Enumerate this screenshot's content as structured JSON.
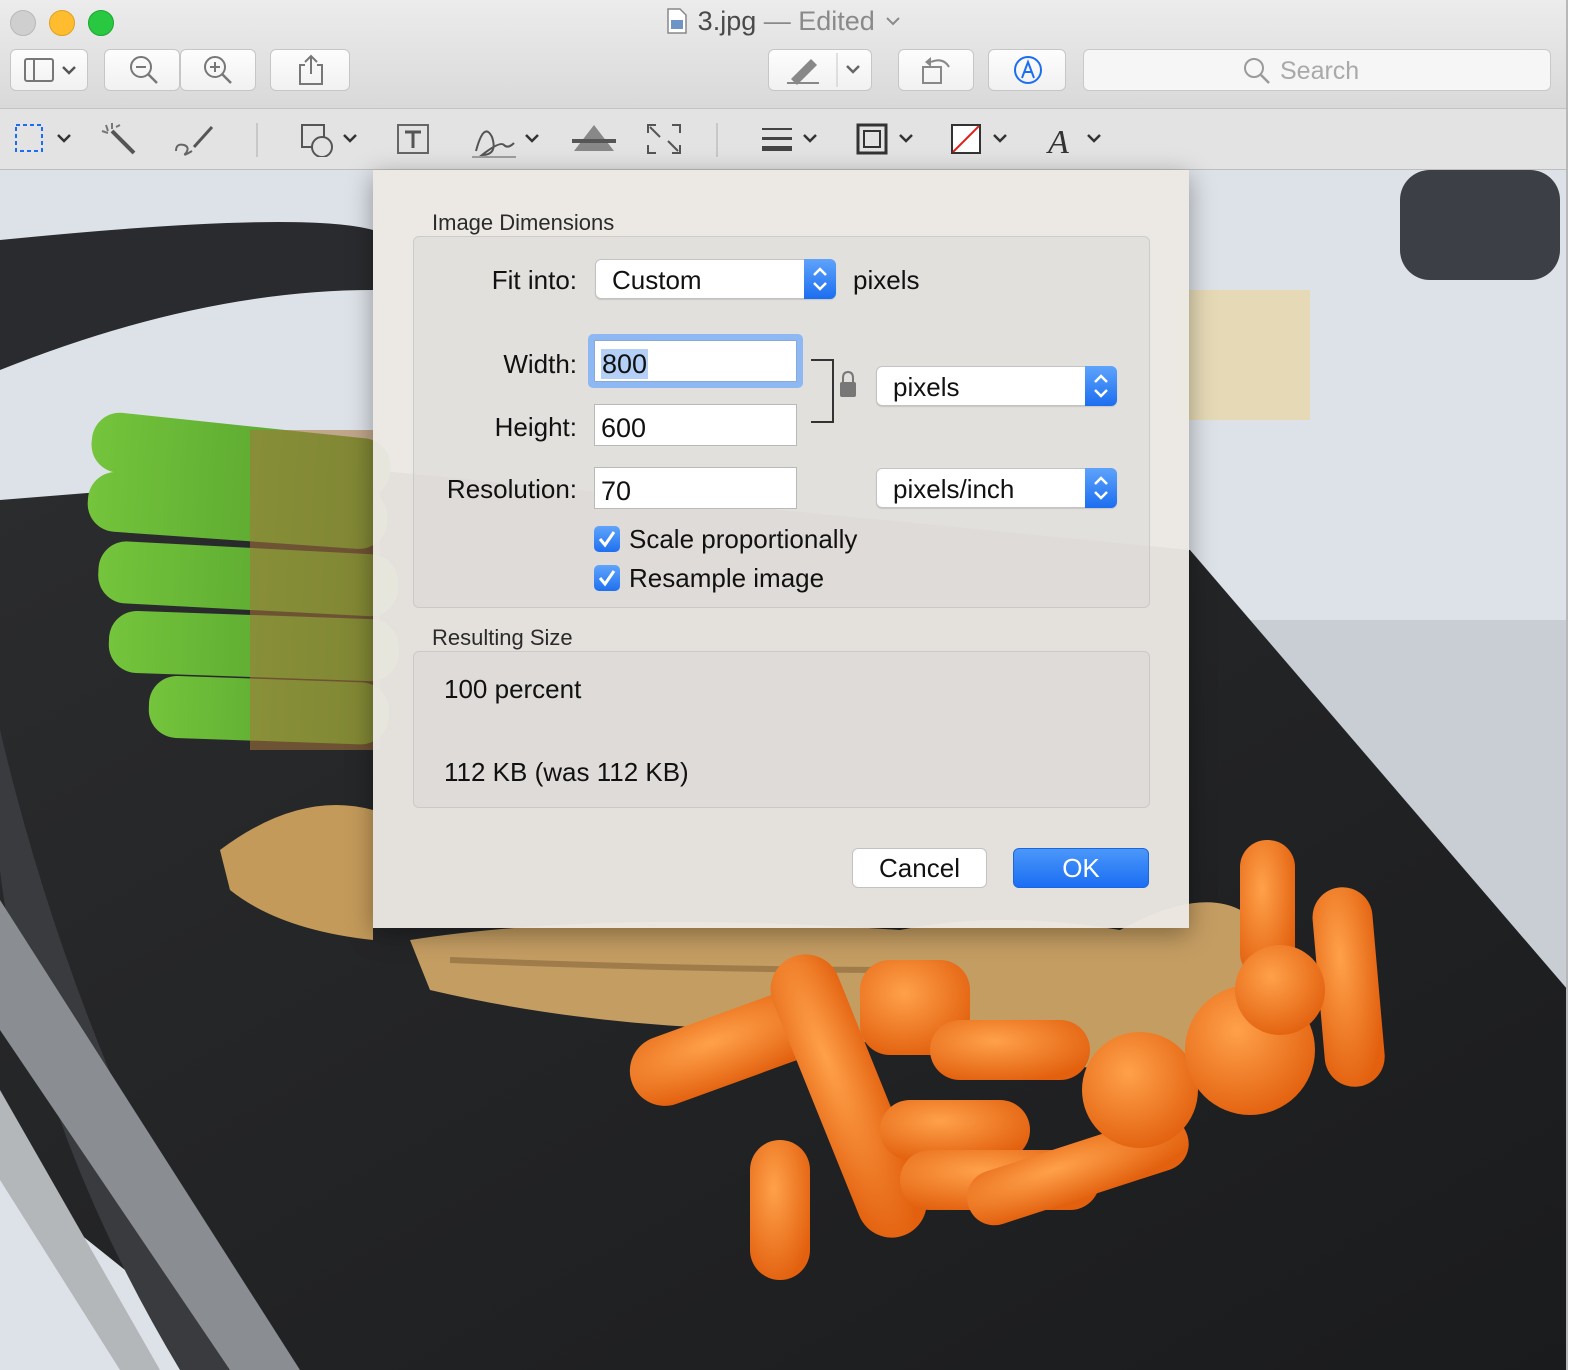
{
  "window": {
    "filename": "3.jpg",
    "status": "— Edited",
    "search_placeholder": "Search"
  },
  "toolbar": {
    "icons": [
      "sidebar-icon",
      "zoom-out-icon",
      "zoom-in-icon",
      "share-icon",
      "markup-pen-icon",
      "rotate-icon",
      "markup-toolbar-icon",
      "search-icon"
    ]
  },
  "markup_toolbar": {
    "icons": [
      "selection-icon",
      "instant-alpha-icon",
      "sketch-icon",
      "shapes-icon",
      "text-icon",
      "sign-icon",
      "adjust-color-icon",
      "adjust-size-icon",
      "shape-style-icon",
      "border-color-icon",
      "fill-color-icon",
      "text-style-icon"
    ]
  },
  "dialog": {
    "image_dimensions_title": "Image Dimensions",
    "fit_into_label": "Fit into:",
    "fit_into_value": "Custom",
    "fit_into_unit": "pixels",
    "width_label": "Width:",
    "width_value": "800",
    "height_label": "Height:",
    "height_value": "600",
    "size_unit": "pixels",
    "resolution_label": "Resolution:",
    "resolution_value": "70",
    "resolution_unit": "pixels/inch",
    "scale_label": "Scale proportionally",
    "scale_checked": true,
    "resample_label": "Resample image",
    "resample_checked": true,
    "resulting_title": "Resulting Size",
    "result_percent": "100 percent",
    "result_size": "112 KB (was 112 KB)",
    "cancel_label": "Cancel",
    "ok_label": "OK"
  },
  "colors": {
    "accent": "#1b6ef3",
    "close": "#ff5f57",
    "minimize": "#febc2e",
    "zoom": "#28c840"
  }
}
